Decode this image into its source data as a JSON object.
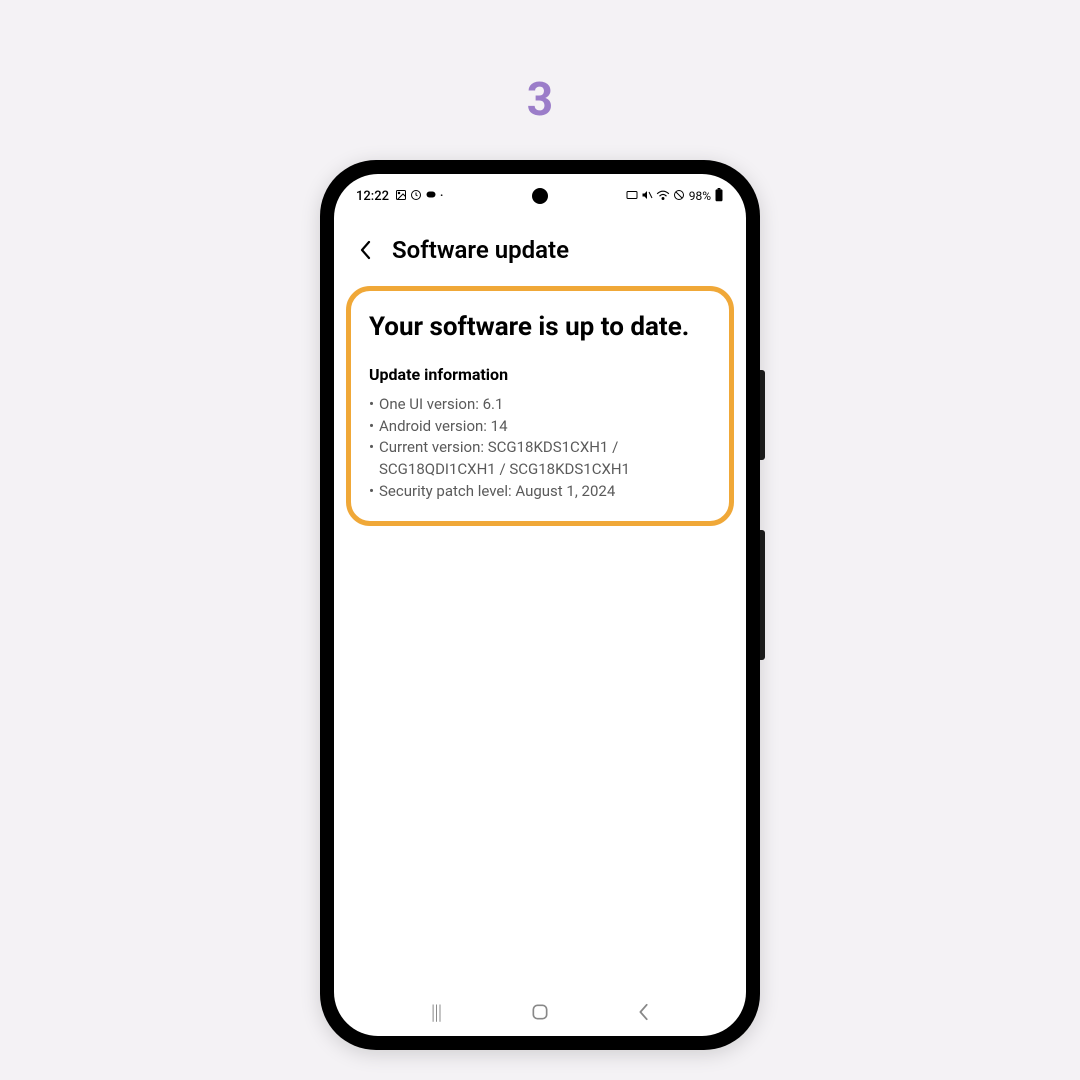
{
  "step_number": "3",
  "status_bar": {
    "time": "12:22",
    "battery_percent": "98%"
  },
  "header": {
    "title": "Software update"
  },
  "card": {
    "status_message": "Your software is up to date.",
    "info_title": "Update information",
    "items": [
      {
        "label": "One UI version: 6.1"
      },
      {
        "label": "Android version: 14"
      },
      {
        "label": "Current version: SCG18KDS1CXH1 / SCG18QDI1CXH1 / SCG18KDS1CXH1"
      },
      {
        "label": "Security patch level: August 1, 2024"
      }
    ]
  }
}
